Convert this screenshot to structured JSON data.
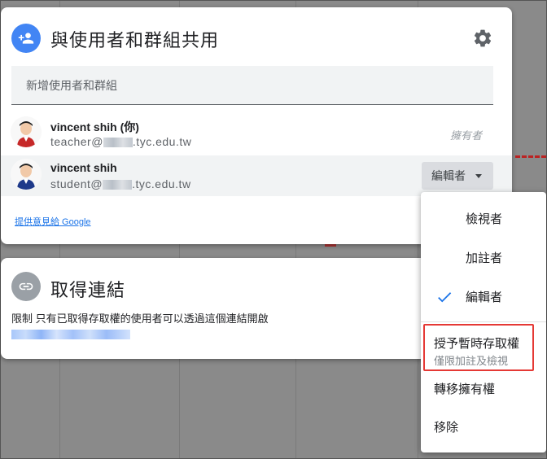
{
  "dialog": {
    "title": "與使用者和群組共用",
    "add_placeholder": "新增使用者和群組",
    "users": [
      {
        "name": "vincent shih (你)",
        "email_prefix": "teacher@",
        "email_suffix": ".tyc.edu.tw",
        "role": "擁有者"
      },
      {
        "name": "vincent shih",
        "email_prefix": "student@",
        "email_suffix": ".tyc.edu.tw",
        "role": "編輯者"
      }
    ],
    "feedback_link": "提供意見給 Google"
  },
  "link_section": {
    "title": "取得連結",
    "restriction": "限制 只有已取得存取權的使用者可以透過這個連結開啟"
  },
  "role_menu": {
    "items": [
      "檢視者",
      "加註者",
      "編輯者"
    ],
    "selected": "編輯者",
    "temp_access": "授予暫時存取權",
    "temp_access_sub": "僅限加註及檢視",
    "transfer": "轉移擁有權",
    "remove": "移除"
  },
  "colors": {
    "accent": "#4285f4",
    "check": "#1a73e8",
    "highlight": "#e53935"
  }
}
